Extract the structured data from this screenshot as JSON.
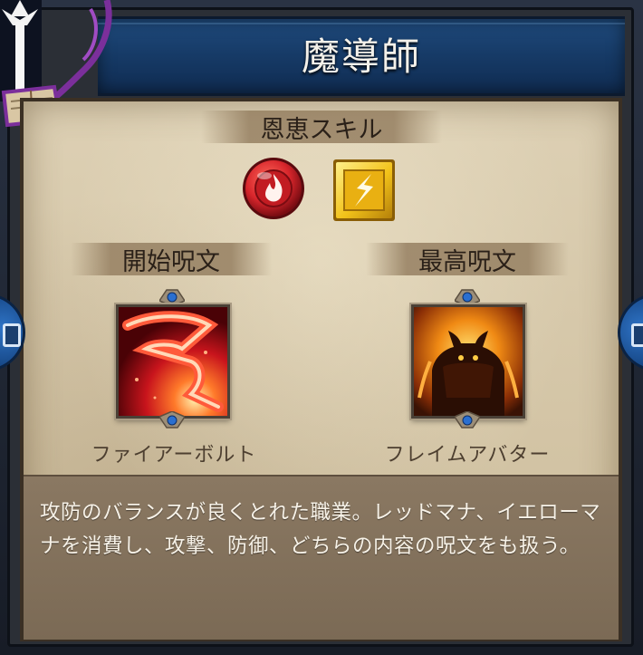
{
  "title": "魔導師",
  "boon_skill": {
    "label": "恩恵スキル",
    "icons": [
      "red-mana-flame-icon",
      "yellow-mana-lightning-icon"
    ]
  },
  "start_spell": {
    "label": "開始呪文",
    "name": "ファイアーボルト",
    "icon": "fire-bolt-icon"
  },
  "top_spell": {
    "label": "最高呪文",
    "name": "フレイムアバター",
    "icon": "flame-avatar-icon"
  },
  "description": "攻防のバランスが良くとれた職業。レッドマナ、イエローマナを消費し、攻撃、防御、どちらの内容の呪文をも扱う。",
  "colors": {
    "red_mana": "#d8262c",
    "yellow_mana": "#f2c21a",
    "title_blue": "#163a66",
    "parchment": "#d6c8aa"
  }
}
